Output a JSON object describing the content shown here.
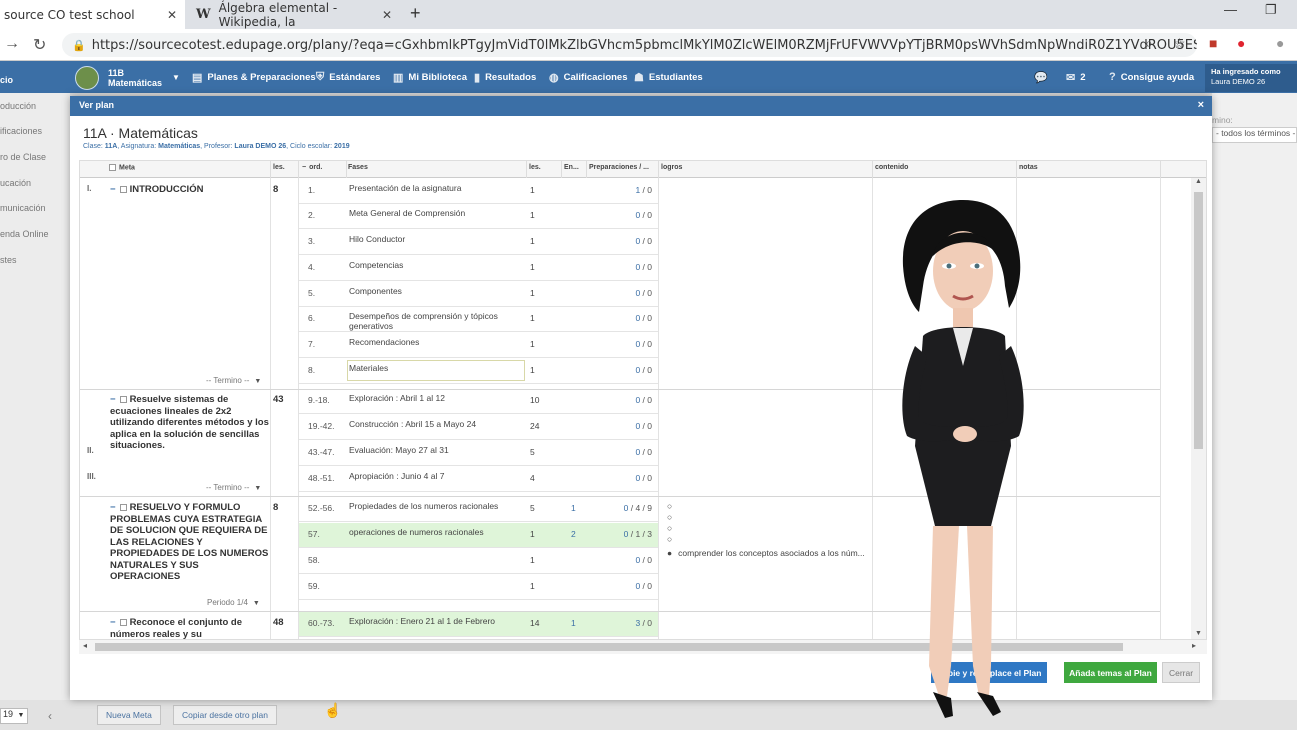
{
  "browser": {
    "tabs": [
      {
        "title": "source CO test school"
      },
      {
        "title": "Álgebra elemental - Wikipedia, la"
      }
    ],
    "url": "https://sourcecotest.edupage.org/plany/?eqa=cGxhbmlkPTgyJmVidT0lMkZlbGVhcm5pbmclMkYlM0ZlcWElM0RZMjFrUFVWVVpYTjBRM0psWVhSdmNpWndiR0Z1YVdROU5ESW1kR1Z6ZEds..."
  },
  "appbar": {
    "class_code": "11B",
    "class_subject": "Matemáticas",
    "menu": [
      "Planes & Preparaciones",
      "Estándares",
      "Mi Biblioteca",
      "Resultados",
      "Calificaciones",
      "Estudiantes"
    ],
    "messages_count": "2",
    "help": "Consigue ayuda",
    "logged_label": "Ha ingresado como",
    "logged_user": "Laura DEMO 26"
  },
  "sidebar": {
    "items": [
      "cio",
      "oducción",
      "ificaciones",
      "ro de Clase",
      "ucación",
      "municación",
      "enda Online",
      "stes"
    ]
  },
  "rightpane": {
    "label": "mino:",
    "select": "- todos los términos -"
  },
  "bottom": {
    "year": "19",
    "new_goal": "Nueva Meta",
    "copy_other": "Copiar desde otro plan"
  },
  "modal": {
    "header": "Ver plan",
    "close": "×",
    "title": "11A · Matemáticas",
    "sub": {
      "clase_label": "Clase:",
      "clase": "11A",
      "asig_label": ", Asignatura:",
      "asig": "Matemáticas",
      "prof_label": ", Profesor:",
      "prof": "Laura DEMO 26",
      "ciclo_label": ", Ciclo escolar:",
      "ciclo": "2019"
    },
    "columns": {
      "meta": "Meta",
      "les": "les.",
      "ord": "ord.",
      "fases": "Fases",
      "les2": "les.",
      "en": "En...",
      "prep": "Preparaciones / ...",
      "logros": "logros",
      "contenido": "contenido",
      "notas": "notas"
    },
    "goals": [
      {
        "roman": "I.",
        "title": "INTRODUCCIÓN",
        "les": "8",
        "period": "-- Termino --"
      },
      {
        "title": "Resuelve sistemas de ecuaciones lineales de 2x2 utilizando diferentes métodos y los aplica en la solución de sencillas situaciones.",
        "les": "43",
        "period": "-- Termino --"
      },
      {
        "title": "RESUELVO Y FORMULO PROBLEMAS CUYA ESTRATEGIA DE SOLUCION QUE REQUIERA DE LAS RELACIONES Y PROPIEDADES DE LOS NUMEROS NATURALES Y SUS OPERACIONES",
        "les": "8",
        "period": "Periodo 1/4"
      },
      {
        "title": "Reconoce el conjunto de números reales y su",
        "les": "48"
      }
    ],
    "romans_extra": [
      "II.",
      "III."
    ],
    "phases": [
      {
        "ord": "1.",
        "fase": "Presentación de la asignatura",
        "les": "1",
        "en": "",
        "pa": "1",
        "pb": "/ 0"
      },
      {
        "ord": "2.",
        "fase": "Meta General de Comprensión",
        "les": "1",
        "en": "",
        "pa": "0",
        "pb": "/ 0"
      },
      {
        "ord": "3.",
        "fase": "Hilo Conductor",
        "les": "1",
        "en": "",
        "pa": "0",
        "pb": "/ 0"
      },
      {
        "ord": "4.",
        "fase": "Competencias",
        "les": "1",
        "en": "",
        "pa": "0",
        "pb": "/ 0"
      },
      {
        "ord": "5.",
        "fase": "Componentes",
        "les": "1",
        "en": "",
        "pa": "0",
        "pb": "/ 0"
      },
      {
        "ord": "6.",
        "fase": "Desempeños de comprensión y tópicos generativos",
        "les": "1",
        "en": "",
        "pa": "0",
        "pb": "/ 0"
      },
      {
        "ord": "7.",
        "fase": "Recomendaciones",
        "les": "1",
        "en": "",
        "pa": "0",
        "pb": "/ 0"
      },
      {
        "ord": "8.",
        "fase": "Materiales",
        "les": "1",
        "en": "",
        "pa": "0",
        "pb": "/ 0"
      },
      {
        "ord": "9.-18.",
        "fase": "Exploración : Abril 1 al 12",
        "les": "10",
        "en": "",
        "pa": "0",
        "pb": "/ 0"
      },
      {
        "ord": "19.-42.",
        "fase": "Construcción : Abril 15 a Mayo 24",
        "les": "24",
        "en": "",
        "pa": "0",
        "pb": "/ 0"
      },
      {
        "ord": "43.-47.",
        "fase": "Evaluación: Mayo 27 al 31",
        "les": "5",
        "en": "",
        "pa": "0",
        "pb": "/ 0"
      },
      {
        "ord": "48.-51.",
        "fase": "Apropiación : Junio 4 al 7",
        "les": "4",
        "en": "",
        "pa": "0",
        "pb": "/ 0"
      },
      {
        "ord": "52.-56.",
        "fase": "Propiedades de los numeros racionales",
        "les": "5",
        "en": "1",
        "pa": "0",
        "pb": "/ 4 / 9"
      },
      {
        "ord": "57.",
        "fase": "operaciones de numeros racionales",
        "les": "1",
        "en": "2",
        "pa": "0",
        "pb": "/ 1 / 3"
      },
      {
        "ord": "58.",
        "fase": "",
        "les": "1",
        "en": "",
        "pa": "0",
        "pb": "/ 0"
      },
      {
        "ord": "59.",
        "fase": "",
        "les": "1",
        "en": "",
        "pa": "0",
        "pb": "/ 0"
      },
      {
        "ord": "60.-73.",
        "fase": "Exploración : Enero 21 al 1 de Febrero",
        "les": "14",
        "en": "1",
        "pa": "3",
        "pb": "/ 0"
      }
    ],
    "logro_text": "comprender los conceptos asociados a los núm...",
    "buttons": {
      "copy_replace": "Copie y reemplace el Plan",
      "add_topics": "Añada temas al Plan",
      "close": "Cerrar"
    }
  },
  "colors": {
    "appbar": "#3b6fa6",
    "green_btn": "#3fa83f",
    "blue_btn": "#2f78c4",
    "row_highlight": "#dff5d9"
  }
}
